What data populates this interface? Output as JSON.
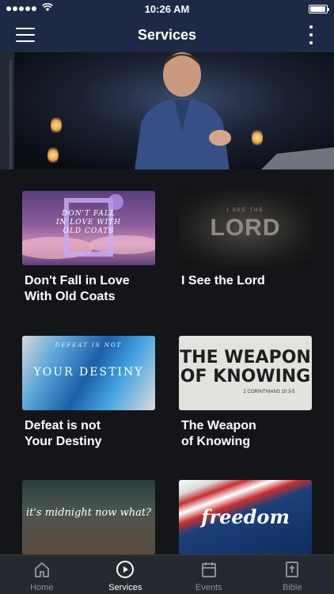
{
  "status_bar": {
    "time": "10:26 AM",
    "signal_dots": 5,
    "battery_level": 0.95
  },
  "nav": {
    "title": "Services",
    "menu_icon": "hamburger-icon",
    "more_icon": "vertical-dots-icon"
  },
  "hero": {
    "image": "preacher-on-stage-photo"
  },
  "services": [
    {
      "title": "Don't Fall in Love\nWith Old Coats",
      "thumb_text": "DON'T FALL\nIN LOVE WITH\nOLD COATS"
    },
    {
      "title": "I See the Lord",
      "thumb_text": "LORD",
      "thumb_subtext": "I SEE THE"
    },
    {
      "title": "Defeat is not\nYour Destiny",
      "thumb_text": "YOUR DESTINY",
      "thumb_subtext": "DEFEAT IS NOT"
    },
    {
      "title": "The Weapon\nof Knowing",
      "thumb_text": "THE WEAPON\nOF KNOWING",
      "thumb_subtext": "2 CORINTHIANS 10:3-5"
    },
    {
      "title": "",
      "thumb_text": "it's midnight now what?"
    },
    {
      "title": "",
      "thumb_text": "freedom"
    }
  ],
  "tabs": [
    {
      "label": "Home",
      "icon": "home-icon",
      "active": false
    },
    {
      "label": "Services",
      "icon": "play-circle-icon",
      "active": true
    },
    {
      "label": "Events",
      "icon": "calendar-icon",
      "active": false
    },
    {
      "label": "Bible",
      "icon": "bible-icon",
      "active": false
    }
  ],
  "colors": {
    "nav_background": "#1e2a45",
    "page_background": "#141518",
    "tab_bar_background": "#26292f",
    "tab_active": "#ffffff",
    "tab_inactive": "#8c8f96"
  }
}
